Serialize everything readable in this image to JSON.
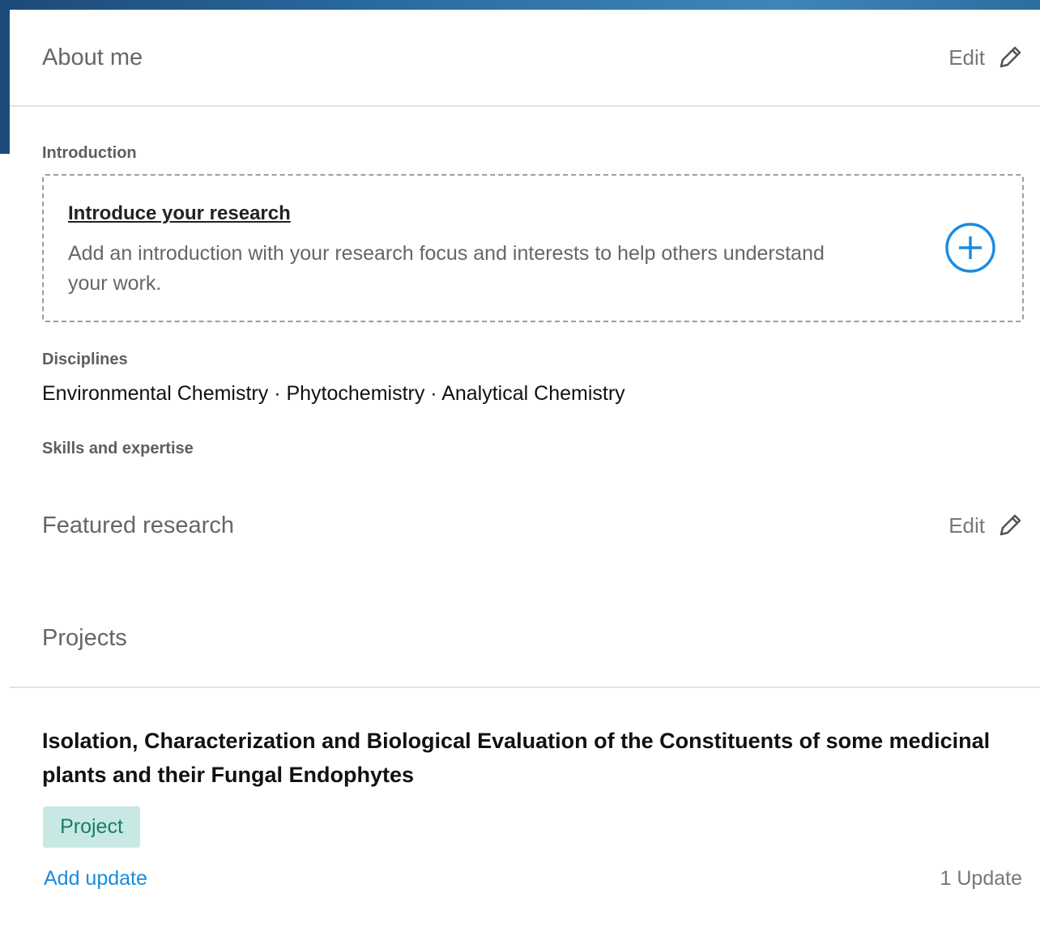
{
  "about": {
    "title": "About me",
    "edit_label": "Edit",
    "introduction": {
      "section_label": "Introduction",
      "link_text": "Introduce your research",
      "description": "Add an introduction with your research focus and interests to help others understand your work."
    },
    "disciplines": {
      "section_label": "Disciplines",
      "items_text": "Environmental Chemistry · Phytochemistry · Analytical Chemistry"
    },
    "skills": {
      "section_label": "Skills and expertise"
    }
  },
  "featured": {
    "title": "Featured research",
    "edit_label": "Edit"
  },
  "projects": {
    "title": "Projects",
    "items": [
      {
        "title": "Isolation, Characterization and Biological Evaluation of the Constituents of some medicinal plants and their Fungal Endophytes",
        "badge": "Project",
        "add_update_label": "Add update",
        "update_count": "1 Update"
      }
    ]
  },
  "icons": {
    "edit": "pencil-icon",
    "add": "plus-circle-icon"
  },
  "colors": {
    "accent_blue": "#1a8be0",
    "badge_bg": "#c7e8e3",
    "badge_text": "#1d7a6f",
    "header_bg": "#2b6ea3"
  }
}
